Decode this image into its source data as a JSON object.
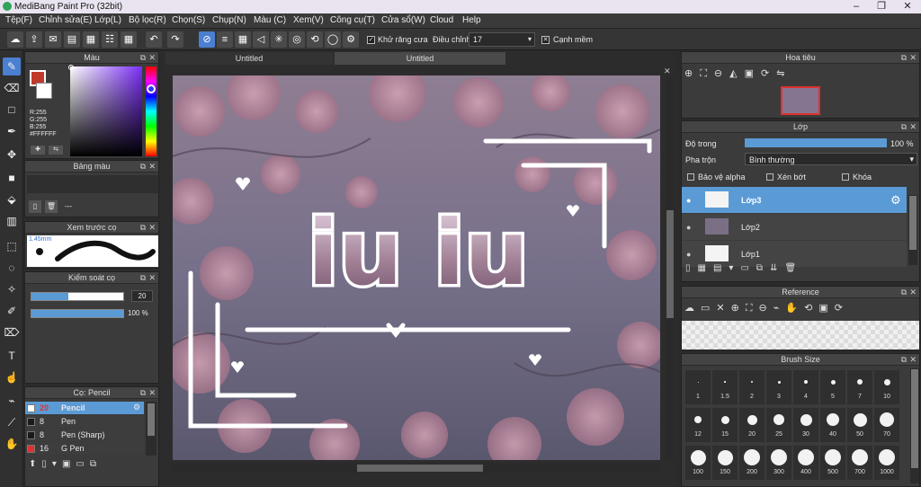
{
  "app": {
    "title": "MediBang Paint Pro (32bit)"
  },
  "menu": [
    "Tệp(F)",
    "Chỉnh sửa(E)",
    "Lớp(L)",
    "Bộ lọc(R)",
    "Chọn(S)",
    "Chụp(N)",
    "Màu (C)",
    "Xem(V)",
    "Công cụ(T)",
    "Cửa sổ(W)",
    "Cloud",
    "Help"
  ],
  "toolbar": {
    "antialias": "Khử răng cưa",
    "correction_label": "Điều chỉnh",
    "correction_value": "17",
    "snap": "Cạnh mềm"
  },
  "color_panel": {
    "title": "Màu",
    "r": "R:255",
    "g": "G:255",
    "b": "B:255",
    "hex": "#FFFFFF"
  },
  "palette_panel": {
    "title": "Bảng màu",
    "extra": "---"
  },
  "brush_preview": {
    "title": "Xem trước cọ",
    "size": "1.45mm"
  },
  "brush_control": {
    "title": "Kiểm soát cọ",
    "size_value": "20",
    "opacity_value": "100 %"
  },
  "brush_list": {
    "title": "Cọ: Pencil",
    "items": [
      {
        "size": "20",
        "name": "Pencil",
        "color": "#ffffff"
      },
      {
        "size": "8",
        "name": "Pen",
        "color": "#1a1a1a"
      },
      {
        "size": "8",
        "name": "Pen (Sharp)",
        "color": "#1a1a1a"
      },
      {
        "size": "16",
        "name": "G Pen",
        "color": "#e03030"
      }
    ]
  },
  "tabs": [
    "Untitled",
    "Untitled"
  ],
  "artwork": {
    "text": "iu iu"
  },
  "navigator": {
    "title": "Hoa tiêu"
  },
  "layers": {
    "title": "Lớp",
    "opacity_label": "Độ trong",
    "opacity_value": "100 %",
    "opacity": 1.0,
    "blend_label": "Pha trộn",
    "blend_value": "Bình thường",
    "protect_alpha": "Bảo vệ alpha",
    "clipping": "Xén bớt",
    "lock": "Khóa",
    "items": [
      "Lớp3",
      "Lớp2",
      "Lớp1"
    ]
  },
  "reference": {
    "title": "Reference"
  },
  "brush_size": {
    "title": "Brush Size",
    "sizes": [
      "1",
      "1.5",
      "2",
      "3",
      "4",
      "5",
      "7",
      "10",
      "12",
      "15",
      "20",
      "25",
      "30",
      "40",
      "50",
      "70",
      "100",
      "150",
      "200",
      "300",
      "400",
      "500",
      "700",
      "1000"
    ]
  },
  "colors": {
    "accent": "#4b7fd1",
    "panel": "#3b3b3b",
    "selection": "#5b9bd5"
  }
}
